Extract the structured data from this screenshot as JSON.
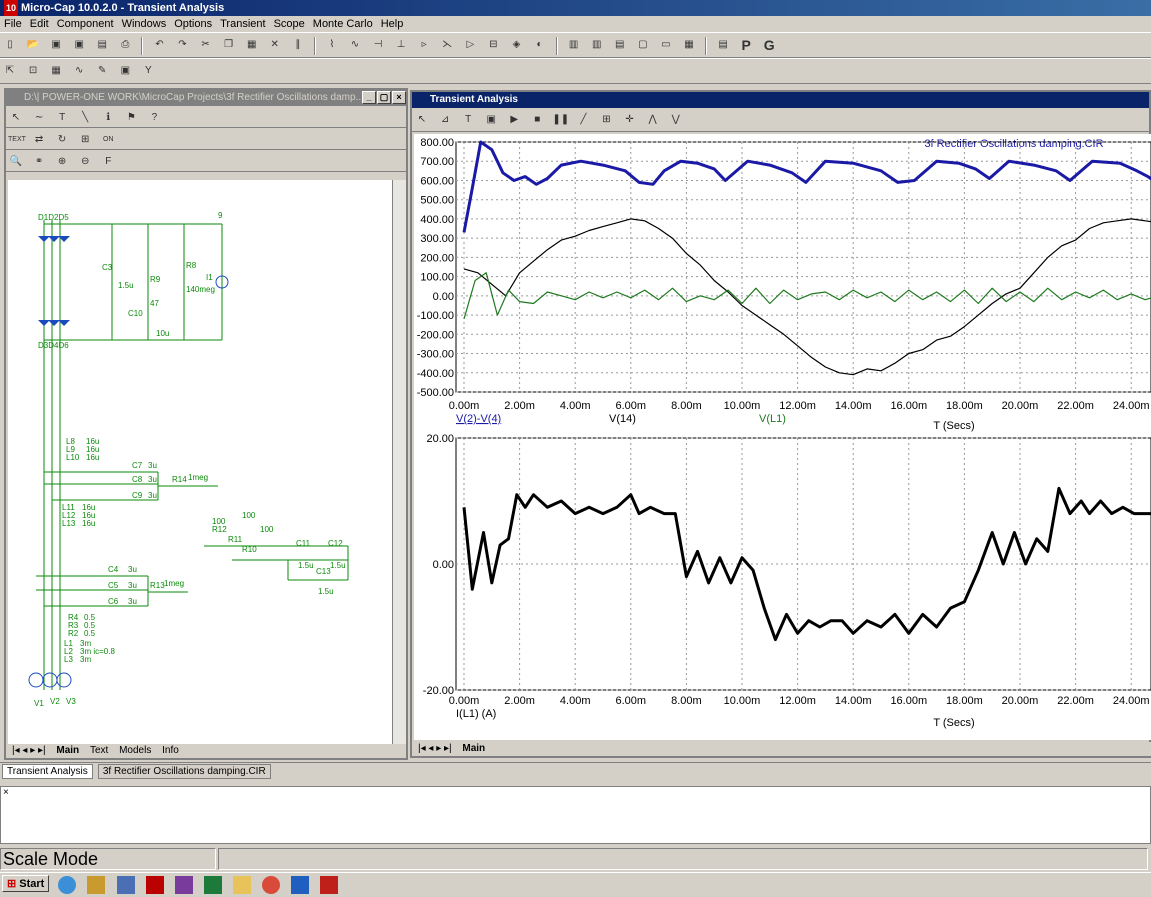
{
  "app": {
    "title": "Micro-Cap 10.0.2.0 - Transient Analysis",
    "icon_text": "10"
  },
  "menu": [
    "File",
    "Edit",
    "Component",
    "Windows",
    "Options",
    "Transient",
    "Scope",
    "Monte Carlo",
    "Help"
  ],
  "schematic_window": {
    "title": "D:\\| POWER-ONE WORK\\MicroCap Projects\\3f Rectifier Oscillations damp...",
    "tabs": [
      "Main",
      "Text",
      "Models",
      "Info"
    ],
    "active_tab": "Main",
    "labels": {
      "d_top": "D1D2D5",
      "node9": "9",
      "c3": "C3",
      "c3v": "1.5u",
      "r9": "R9",
      "r9v": "47",
      "r8": "R8",
      "r8v": "140meg",
      "i1": "I1",
      "c10": "C10",
      "c10v": "10u",
      "d_bot": "D3D4D6",
      "l_top1": "L8",
      "l_top2": "L9",
      "l_top3": "L10",
      "l_topv1": "16u",
      "l_topv2": "16u",
      "l_topv3": "16u",
      "c7": "C7",
      "c7v": "3u",
      "c8": "C8",
      "c8v": "3u",
      "c9": "C9",
      "c9v": "3u",
      "r14": "R14",
      "r14v": "1meg",
      "l_mid": "L11",
      "l_mid2": "L12",
      "l_mid3": "L13",
      "l_midv1": "16u",
      "l_midv2": "16u",
      "l_midv3": "16u",
      "r12v": "100",
      "r12": "R12",
      "r11": "R11",
      "r10": "R10",
      "r11v": "100",
      "r10v": "100",
      "c11": "C11",
      "c12": "C12",
      "c11v": "1.5u",
      "c12v": "1.5u",
      "c13": "C13",
      "c13v": "1.5u",
      "c4": "C4",
      "c4v": "3u",
      "c5": "C5",
      "c5v": "3u",
      "c6": "C6",
      "c6v": "3u",
      "r13": "R13",
      "r13v": "1meg",
      "r4": "R4",
      "r4v": "0.5",
      "r3": "R3",
      "r3v": "0.5",
      "r2": "R2",
      "r2v": "0.5",
      "l1": "L1",
      "l1v": "3m",
      "l2": "L2",
      "l2v": "3m ic=0.8",
      "l3": "L3",
      "l3v": "3m",
      "v1": "V1",
      "v2": "V2",
      "v3": "V3"
    }
  },
  "analysis_window": {
    "title": "Transient Analysis",
    "circuit_name": "3f Rectifier Oscillations damping.CIR",
    "tab": "Main"
  },
  "mdi_tabs": [
    "Transient Analysis",
    "3f Rectifier Oscillations damping.CIR"
  ],
  "status_text": "Scale Mode",
  "taskbar": {
    "start_label": "Start"
  },
  "colors": {
    "trace_blue": "#1a1aa6",
    "trace_black": "#000000",
    "trace_green": "#1e7a1e",
    "schematic_green": "#0a8a0a"
  },
  "chart_data": [
    {
      "type": "line",
      "title": "3f Rectifier Oscillations damping.CIR",
      "xlabel": "T (Secs)",
      "x_ticks": [
        "0.00m",
        "2.00m",
        "4.00m",
        "6.00m",
        "8.00m",
        "10.00m",
        "12.00m",
        "14.00m",
        "16.00m",
        "18.00m",
        "20.00m",
        "22.00m",
        "24.00m"
      ],
      "y_ticks": [
        "800.00",
        "700.00",
        "600.00",
        "500.00",
        "400.00",
        "300.00",
        "200.00",
        "100.00",
        "0.00",
        "-100.00",
        "-200.00",
        "-300.00",
        "-400.00",
        "-500.00"
      ],
      "xlim": [
        0,
        25
      ],
      "ylim": [
        -500,
        800
      ],
      "grid": true,
      "series": [
        {
          "name": "V(2)-V(4)",
          "color": "#1a1aa6",
          "x": [
            0,
            0.3,
            0.6,
            1.0,
            1.4,
            1.8,
            2.2,
            2.6,
            3.0,
            3.5,
            4.2,
            5.0,
            5.8,
            6.3,
            6.8,
            7.2,
            7.8,
            8.4,
            9.0,
            9.4,
            10.2,
            11.0,
            11.8,
            12.3,
            13.0,
            14.0,
            15.0,
            15.6,
            16.2,
            17.0,
            17.8,
            18.4,
            18.9,
            19.6,
            20.5,
            21.3,
            21.8,
            22.6,
            23.6,
            24.2,
            24.6,
            25.0
          ],
          "y": [
            330,
            560,
            800,
            760,
            640,
            600,
            620,
            580,
            610,
            680,
            700,
            680,
            650,
            590,
            580,
            650,
            700,
            690,
            660,
            600,
            700,
            680,
            640,
            590,
            700,
            690,
            650,
            590,
            600,
            700,
            690,
            660,
            610,
            700,
            680,
            650,
            600,
            700,
            690,
            650,
            620,
            580
          ]
        },
        {
          "name": "V(14)",
          "color": "#000000",
          "x": [
            0,
            0.5,
            1.0,
            1.5,
            2.0,
            2.5,
            3.0,
            3.5,
            4.0,
            4.5,
            5.0,
            5.5,
            6.0,
            6.5,
            7.0,
            7.5,
            8.0,
            8.5,
            9.0,
            9.5,
            10.0,
            10.5,
            11.0,
            11.5,
            12.0,
            12.5,
            13.0,
            13.5,
            14.0,
            14.5,
            15.0,
            15.5,
            16.0,
            16.5,
            17.0,
            17.5,
            18.0,
            18.5,
            19.0,
            19.5,
            20.0,
            20.5,
            21.0,
            21.5,
            22.0,
            22.5,
            23.0,
            23.5,
            24.0,
            24.5,
            25.0
          ],
          "y": [
            140,
            120,
            60,
            0,
            120,
            180,
            240,
            290,
            310,
            340,
            360,
            380,
            400,
            390,
            350,
            300,
            220,
            160,
            80,
            20,
            -50,
            -100,
            -150,
            -200,
            -260,
            -320,
            -370,
            -400,
            -410,
            -380,
            -390,
            -350,
            -300,
            -280,
            -230,
            -210,
            -160,
            -100,
            -40,
            10,
            40,
            120,
            200,
            260,
            290,
            350,
            380,
            390,
            400,
            390,
            380
          ]
        },
        {
          "name": "V(L1)",
          "color": "#1e7a1e",
          "x": [
            0,
            0.4,
            0.8,
            1.2,
            1.6,
            2.0,
            2.5,
            3.0,
            3.5,
            4.0,
            4.5,
            5.0,
            5.5,
            6.0,
            6.5,
            7.0,
            7.5,
            8.0,
            8.5,
            9.0,
            9.5,
            10.0,
            10.5,
            11.0,
            11.5,
            12.0,
            12.5,
            13.0,
            13.5,
            14.0,
            14.5,
            15.0,
            15.5,
            16.0,
            16.5,
            17.0,
            17.5,
            18.0,
            18.5,
            19.0,
            19.5,
            20.0,
            20.5,
            21.0,
            21.5,
            22.0,
            22.5,
            23.0,
            23.5,
            24.0,
            24.5,
            25.0
          ],
          "y": [
            -120,
            80,
            120,
            -100,
            30,
            -30,
            -40,
            20,
            0,
            -20,
            20,
            -10,
            20,
            -10,
            30,
            -20,
            40,
            -30,
            0,
            -20,
            30,
            -40,
            40,
            -40,
            30,
            -20,
            10,
            20,
            -20,
            30,
            -10,
            20,
            -30,
            30,
            -20,
            20,
            -30,
            30,
            -40,
            40,
            -30,
            20,
            -30,
            40,
            -20,
            20,
            -10,
            30,
            -20,
            10,
            -20,
            0
          ]
        }
      ]
    },
    {
      "type": "line",
      "xlabel": "T (Secs)",
      "x_ticks": [
        "0.00m",
        "2.00m",
        "4.00m",
        "6.00m",
        "8.00m",
        "10.00m",
        "12.00m",
        "14.00m",
        "16.00m",
        "18.00m",
        "20.00m",
        "22.00m",
        "24.00m"
      ],
      "y_ticks": [
        "20.00",
        "0.00",
        "-20.00"
      ],
      "xlim": [
        0,
        25
      ],
      "ylim": [
        -20,
        20
      ],
      "grid": true,
      "series": [
        {
          "name": "I(L1) (A)",
          "color": "#000000",
          "x": [
            0,
            0.3,
            0.7,
            1.0,
            1.3,
            1.6,
            1.9,
            2.2,
            2.5,
            3.0,
            3.5,
            4.0,
            4.5,
            5.0,
            5.5,
            6.0,
            6.3,
            6.7,
            7.2,
            7.6,
            8.0,
            8.4,
            8.8,
            9.2,
            9.6,
            10.0,
            10.4,
            10.8,
            11.2,
            11.6,
            12.0,
            12.4,
            12.8,
            13.2,
            13.6,
            14.0,
            14.5,
            15.0,
            15.5,
            16.0,
            16.5,
            17.0,
            17.5,
            18.0,
            18.5,
            19.0,
            19.4,
            19.8,
            20.2,
            20.6,
            21.0,
            21.4,
            21.8,
            22.2,
            22.5,
            22.9,
            23.3,
            23.7,
            24.1,
            24.5,
            25.0
          ],
          "y": [
            9,
            -4,
            5,
            -3,
            3,
            4,
            11,
            9,
            11,
            9,
            10,
            8,
            9,
            8,
            9,
            11,
            8,
            9,
            8,
            8,
            -2,
            2,
            -3,
            1,
            -3,
            1,
            -1,
            -7,
            -12,
            -8,
            -11,
            -9,
            -10,
            -9,
            -9,
            -11,
            -9,
            -10,
            -8,
            -11,
            -8,
            -10,
            -7,
            -6,
            -1,
            5,
            0,
            5,
            0,
            4,
            2,
            12,
            8,
            10,
            8,
            10,
            8,
            9,
            8,
            8,
            8
          ]
        }
      ]
    }
  ]
}
